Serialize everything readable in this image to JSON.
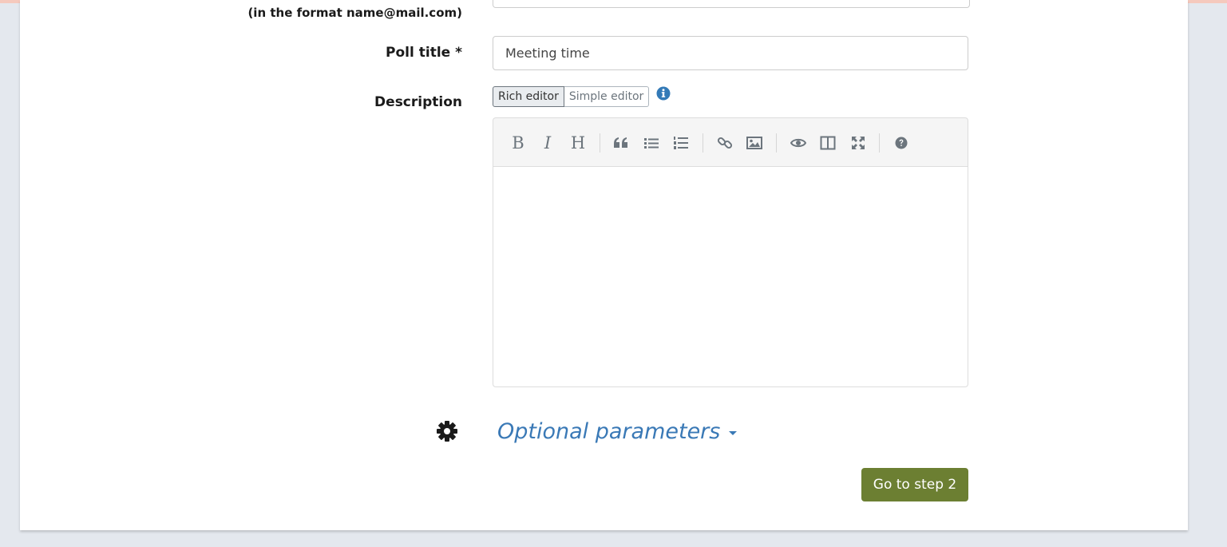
{
  "form": {
    "email_hint": "(in the format name@mail.com)",
    "poll_title_label": "Poll title *",
    "poll_title_value": "Meeting time",
    "description_label": "Description",
    "editor_toggle": {
      "rich_label": "Rich editor",
      "simple_label": "Simple editor",
      "selected": "Rich editor"
    },
    "toolbar": {
      "bold_glyph": "B",
      "italic_glyph": "I",
      "heading_glyph": "H",
      "tools": [
        "bold-icon",
        "italic-icon",
        "heading-icon",
        "quote-icon",
        "unordered-list-icon",
        "ordered-list-icon",
        "link-icon",
        "image-icon",
        "preview-icon",
        "side-by-side-icon",
        "fullscreen-icon",
        "help-icon"
      ]
    },
    "optional_parameters_label": "Optional parameters",
    "submit_label": "Go to step 2"
  },
  "colors": {
    "page_background": "#e4e8ee",
    "link_blue": "#3a79b6",
    "submit_green": "#6c7f32",
    "info_blue": "#337ab7",
    "toolbar_icon": "#6c757d"
  }
}
